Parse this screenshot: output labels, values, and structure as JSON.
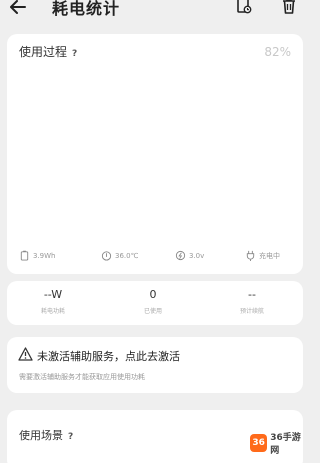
{
  "header": {
    "title": "耗电统计",
    "back_icon": "back-arrow-icon",
    "history_icon": "history-icon",
    "delete_icon": "trash-icon"
  },
  "usage": {
    "title": "使用过程",
    "help": "?",
    "percent": "82%",
    "stats": [
      {
        "icon": "battery-icon",
        "value": "3.9Wh"
      },
      {
        "icon": "thermometer-icon",
        "value": "36.0℃"
      },
      {
        "icon": "voltage-icon",
        "value": "3.0v"
      },
      {
        "icon": "charging-plug-icon",
        "value": "充电中"
      }
    ]
  },
  "summary": [
    {
      "value": "--W",
      "label": "耗电功耗"
    },
    {
      "value": "0",
      "label": "已使用"
    },
    {
      "value": "--",
      "label": "预计续航"
    }
  ],
  "warning": {
    "title": "未激活辅助服务，点此去激活",
    "description": "需要激活辅助服务才能获取应用使用功耗"
  },
  "scene": {
    "title": "使用场景",
    "help": "?"
  },
  "watermark": {
    "logo": "36",
    "text": "36手游网"
  }
}
